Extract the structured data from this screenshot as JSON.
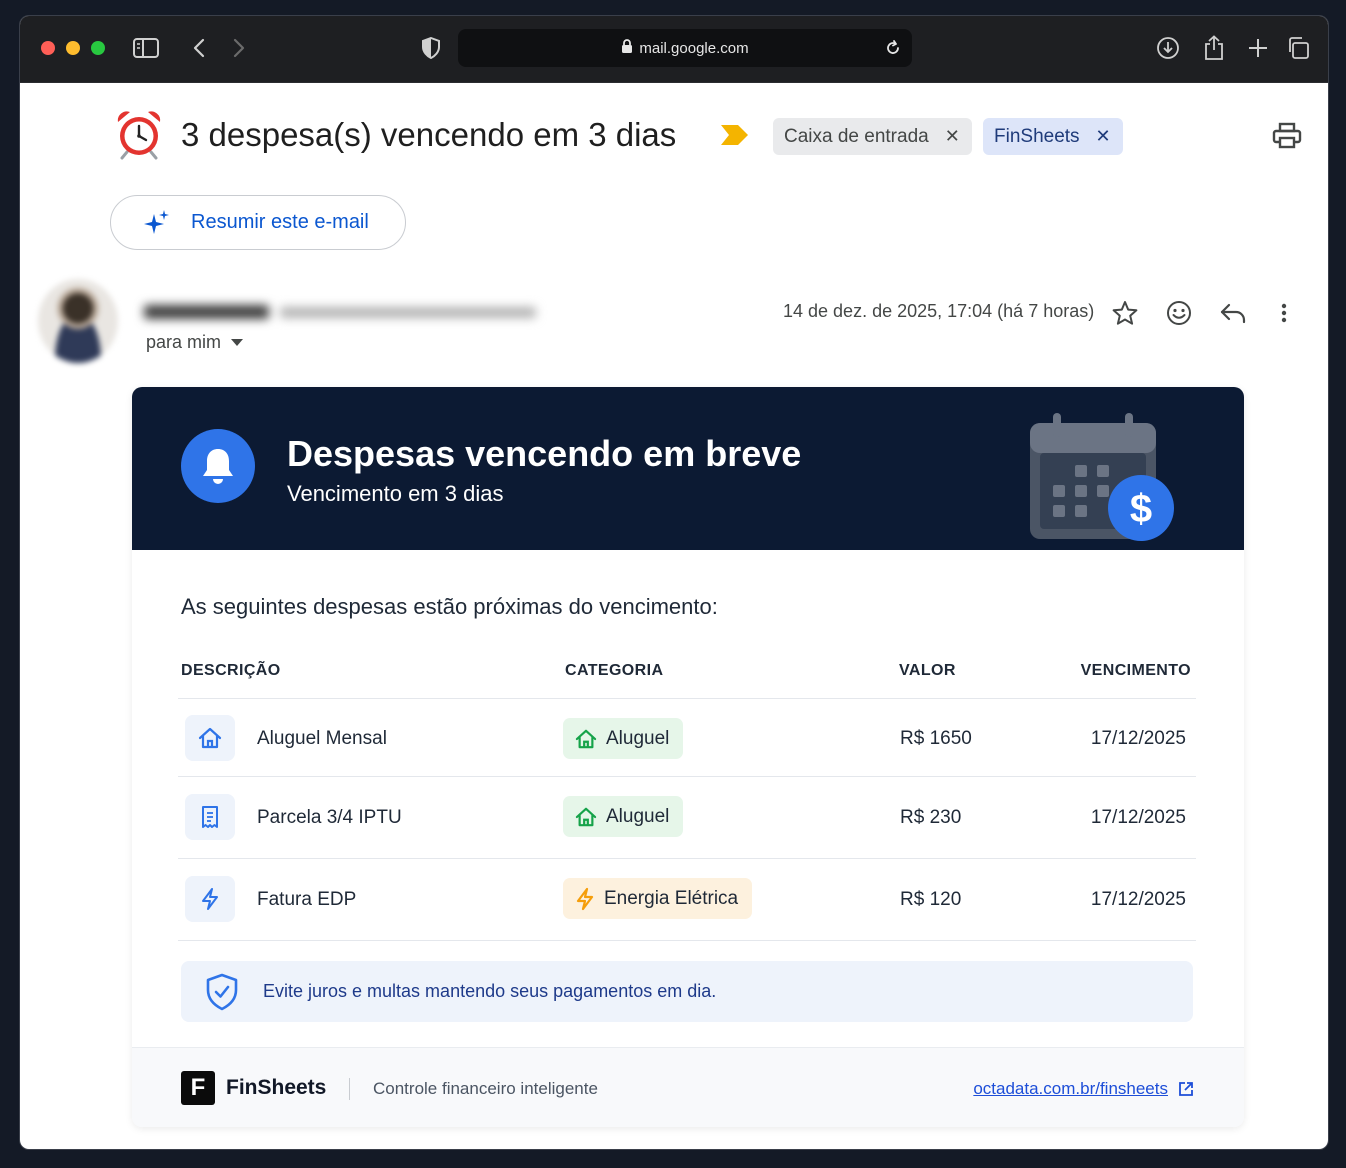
{
  "browser": {
    "url": "mail.google.com"
  },
  "email": {
    "subject": "3 despesa(s) vencendo em 3 dias",
    "labels": [
      "Caixa de entrada",
      "FinSheets"
    ],
    "label_close": "✕",
    "summarize_label": "Resumir este e-mail",
    "to_label": "para mim",
    "date": "14 de dez. de 2025, 17:04 (há 7 horas)"
  },
  "card": {
    "title": "Despesas vencendo em breve",
    "subtitle": "Vencimento em 3 dias",
    "intro": "As seguintes despesas estão próximas do vencimento:",
    "columns": {
      "description": "DESCRIÇÃO",
      "category": "CATEGORIA",
      "value": "VALOR",
      "due": "VENCIMENTO"
    },
    "rows": [
      {
        "icon": "home-icon",
        "description": "Aluguel Mensal",
        "category": "Aluguel",
        "category_icon": "home-icon",
        "category_color": "#16a34a",
        "value": "R$ 1650",
        "due": "17/12/2025"
      },
      {
        "icon": "receipt-icon",
        "description": "Parcela 3/4 IPTU",
        "category": "Aluguel",
        "category_icon": "home-icon",
        "category_color": "#16a34a",
        "value": "R$ 230",
        "due": "17/12/2025"
      },
      {
        "icon": "bolt-icon",
        "description": "Fatura EDP",
        "category": "Energia Elétrica",
        "category_icon": "bolt-icon",
        "category_color": "#f59e0b",
        "value": "R$ 120",
        "due": "17/12/2025"
      }
    ],
    "tip": "Evite juros e multas mantendo seus pagamentos em dia.",
    "footer": {
      "logo_letter": "F",
      "brand": "FinSheets",
      "tagline": "Controle financeiro inteligente",
      "link": "octadata.com.br/finsheets"
    }
  },
  "colors": {
    "accent": "#0b57d0",
    "banner": "#0c1a33",
    "bell": "#2f74e8"
  }
}
